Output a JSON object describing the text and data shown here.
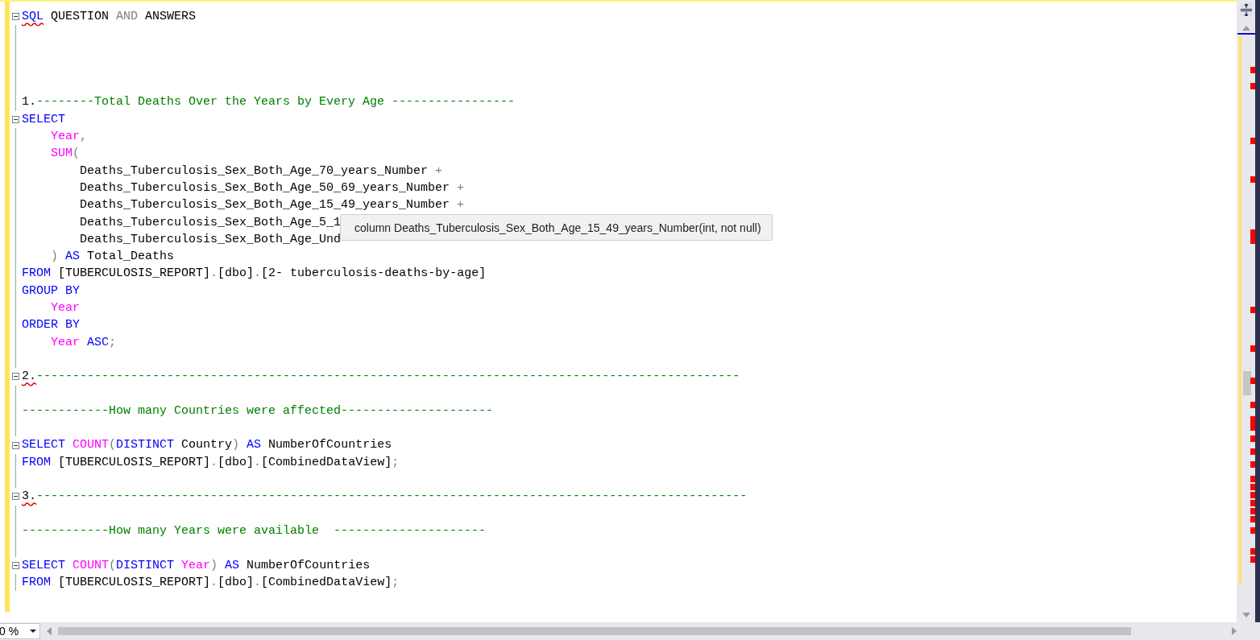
{
  "editor": {
    "lines": [
      {
        "kind": "code",
        "fold": true,
        "tokens": [
          {
            "kind": "keyword",
            "text": "SQL",
            "squiggle": true
          },
          {
            "kind": "plain",
            "text": " QUESTION "
          },
          {
            "kind": "operator",
            "text": "AND"
          },
          {
            "kind": "plain",
            "text": " ANSWERS"
          }
        ]
      },
      {
        "kind": "blank"
      },
      {
        "kind": "blank"
      },
      {
        "kind": "blank"
      },
      {
        "kind": "blank"
      },
      {
        "kind": "code",
        "fold": false,
        "tokens": [
          {
            "kind": "plain",
            "text": "1."
          },
          {
            "kind": "comment",
            "text": "--------Total Deaths Over the Years by Every Age -----------------"
          }
        ]
      },
      {
        "kind": "code",
        "fold": true,
        "tokens": [
          {
            "kind": "keyword",
            "text": "SELECT"
          }
        ]
      },
      {
        "kind": "code",
        "fold": false,
        "tokens": [
          {
            "kind": "function",
            "text": "    Year"
          },
          {
            "kind": "operator",
            "text": ","
          }
        ]
      },
      {
        "kind": "code",
        "fold": false,
        "tokens": [
          {
            "kind": "function",
            "text": "    SUM"
          },
          {
            "kind": "operator",
            "text": "("
          }
        ]
      },
      {
        "kind": "code",
        "fold": false,
        "tokens": [
          {
            "kind": "plain",
            "text": "        Deaths_Tuberculosis_Sex_Both_Age_70_years_Number "
          },
          {
            "kind": "operator",
            "text": "+"
          }
        ]
      },
      {
        "kind": "code",
        "fold": false,
        "tokens": [
          {
            "kind": "plain",
            "text": "        Deaths_Tuberculosis_Sex_Both_Age_50_69_years_Number "
          },
          {
            "kind": "operator",
            "text": "+"
          }
        ]
      },
      {
        "kind": "code",
        "fold": false,
        "tokens": [
          {
            "kind": "plain",
            "text": "        Deaths_Tuberculosis_Sex_Both_Age_15_49_years_Number "
          },
          {
            "kind": "operator",
            "text": "+"
          }
        ]
      },
      {
        "kind": "code",
        "fold": false,
        "tokens": [
          {
            "kind": "plain",
            "text": "        Deaths_Tuberculosis_Sex_Both_Age_5_1"
          }
        ]
      },
      {
        "kind": "code",
        "fold": false,
        "tokens": [
          {
            "kind": "plain",
            "text": "        Deaths_Tuberculosis_Sex_Both_Age_Und"
          }
        ]
      },
      {
        "kind": "code",
        "fold": false,
        "tokens": [
          {
            "kind": "operator",
            "text": "    ) "
          },
          {
            "kind": "keyword",
            "text": "AS"
          },
          {
            "kind": "plain",
            "text": " Total_Deaths"
          }
        ]
      },
      {
        "kind": "code",
        "fold": false,
        "tokens": [
          {
            "kind": "keyword",
            "text": "FROM"
          },
          {
            "kind": "plain",
            "text": " [TUBERCULOSIS_REPORT]"
          },
          {
            "kind": "operator",
            "text": "."
          },
          {
            "kind": "plain",
            "text": "[dbo]"
          },
          {
            "kind": "operator",
            "text": "."
          },
          {
            "kind": "plain",
            "text": "[2- tuberculosis-deaths-by-age]"
          }
        ]
      },
      {
        "kind": "code",
        "fold": false,
        "tokens": [
          {
            "kind": "keyword",
            "text": "GROUP BY"
          }
        ]
      },
      {
        "kind": "code",
        "fold": false,
        "tokens": [
          {
            "kind": "function",
            "text": "    Year"
          }
        ]
      },
      {
        "kind": "code",
        "fold": false,
        "tokens": [
          {
            "kind": "keyword",
            "text": "ORDER BY"
          }
        ]
      },
      {
        "kind": "code",
        "fold": false,
        "tokens": [
          {
            "kind": "function",
            "text": "    Year"
          },
          {
            "kind": "keyword",
            "text": " ASC"
          },
          {
            "kind": "operator",
            "text": ";"
          }
        ]
      },
      {
        "kind": "blank"
      },
      {
        "kind": "code",
        "fold": true,
        "tokens": [
          {
            "kind": "plain",
            "text": "2.",
            "squiggle": true
          },
          {
            "kind": "comment",
            "text": "-------------------------------------------------------------------------------------------------"
          }
        ]
      },
      {
        "kind": "blank"
      },
      {
        "kind": "code",
        "fold": false,
        "tokens": [
          {
            "kind": "comment",
            "text": "------------How many Countries were affected---------------------"
          }
        ]
      },
      {
        "kind": "blank"
      },
      {
        "kind": "code",
        "fold": true,
        "tokens": [
          {
            "kind": "keyword",
            "text": "SELECT "
          },
          {
            "kind": "function",
            "text": "COUNT"
          },
          {
            "kind": "operator",
            "text": "("
          },
          {
            "kind": "keyword",
            "text": "DISTINCT"
          },
          {
            "kind": "plain",
            "text": " Country"
          },
          {
            "kind": "operator",
            "text": ") "
          },
          {
            "kind": "keyword",
            "text": "AS"
          },
          {
            "kind": "plain",
            "text": " NumberOfCountries"
          }
        ]
      },
      {
        "kind": "code",
        "fold": false,
        "tokens": [
          {
            "kind": "keyword",
            "text": "FROM"
          },
          {
            "kind": "plain",
            "text": " [TUBERCULOSIS_REPORT]"
          },
          {
            "kind": "operator",
            "text": "."
          },
          {
            "kind": "plain",
            "text": "[dbo]"
          },
          {
            "kind": "operator",
            "text": "."
          },
          {
            "kind": "plain",
            "text": "[CombinedDataView]"
          },
          {
            "kind": "operator",
            "text": ";"
          }
        ]
      },
      {
        "kind": "blank"
      },
      {
        "kind": "code",
        "fold": true,
        "tokens": [
          {
            "kind": "plain",
            "text": "3.",
            "squiggle": true
          },
          {
            "kind": "comment",
            "text": "--------------------------------------------------------------------------------------------------"
          }
        ]
      },
      {
        "kind": "blank"
      },
      {
        "kind": "code",
        "fold": false,
        "tokens": [
          {
            "kind": "comment",
            "text": "------------How many Years were available  ---------------------"
          }
        ]
      },
      {
        "kind": "blank"
      },
      {
        "kind": "code",
        "fold": true,
        "tokens": [
          {
            "kind": "keyword",
            "text": "SELECT "
          },
          {
            "kind": "function",
            "text": "COUNT"
          },
          {
            "kind": "operator",
            "text": "("
          },
          {
            "kind": "keyword",
            "text": "DISTINCT "
          },
          {
            "kind": "function",
            "text": "Year"
          },
          {
            "kind": "operator",
            "text": ") "
          },
          {
            "kind": "keyword",
            "text": "AS"
          },
          {
            "kind": "plain",
            "text": " NumberOfCountries"
          }
        ]
      },
      {
        "kind": "code",
        "fold": false,
        "tokens": [
          {
            "kind": "keyword",
            "text": "FROM"
          },
          {
            "kind": "plain",
            "text": " [TUBERCULOSIS_REPORT]"
          },
          {
            "kind": "operator",
            "text": "."
          },
          {
            "kind": "plain",
            "text": "[dbo]"
          },
          {
            "kind": "operator",
            "text": "."
          },
          {
            "kind": "plain",
            "text": "[CombinedDataView]"
          },
          {
            "kind": "operator",
            "text": ";"
          }
        ]
      }
    ],
    "tooltip": "column Deaths_Tuberculosis_Sex_Both_Age_15_49_years_Number(int, not null)"
  },
  "zoom": {
    "value": "0 %"
  }
}
